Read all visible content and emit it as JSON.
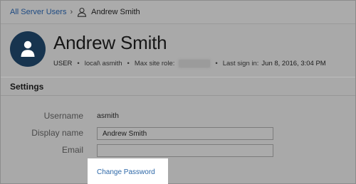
{
  "breadcrumb": {
    "parent_label": "All Server Users",
    "separator": "›",
    "current_label": "Andrew Smith"
  },
  "header": {
    "name": "Andrew Smith",
    "role": "USER",
    "username_display": "local\\ asmith",
    "max_site_role_label": "Max site role:",
    "last_signin_label": "Last sign in:",
    "last_signin_value": "Jun 8, 2016, 3:04 PM"
  },
  "settings": {
    "title": "Settings",
    "username_label": "Username",
    "username_value": "asmith",
    "display_name_label": "Display name",
    "display_name_value": "Andrew Smith",
    "email_label": "Email",
    "email_value": "",
    "change_password_label": "Change Password"
  },
  "icons": {
    "breadcrumb_user": "user-outline-icon",
    "avatar": "user-silhouette-icon"
  },
  "colors": {
    "link": "#1d4a82",
    "avatar_bg": "#17344f",
    "overlay": "#a9a9a9"
  }
}
